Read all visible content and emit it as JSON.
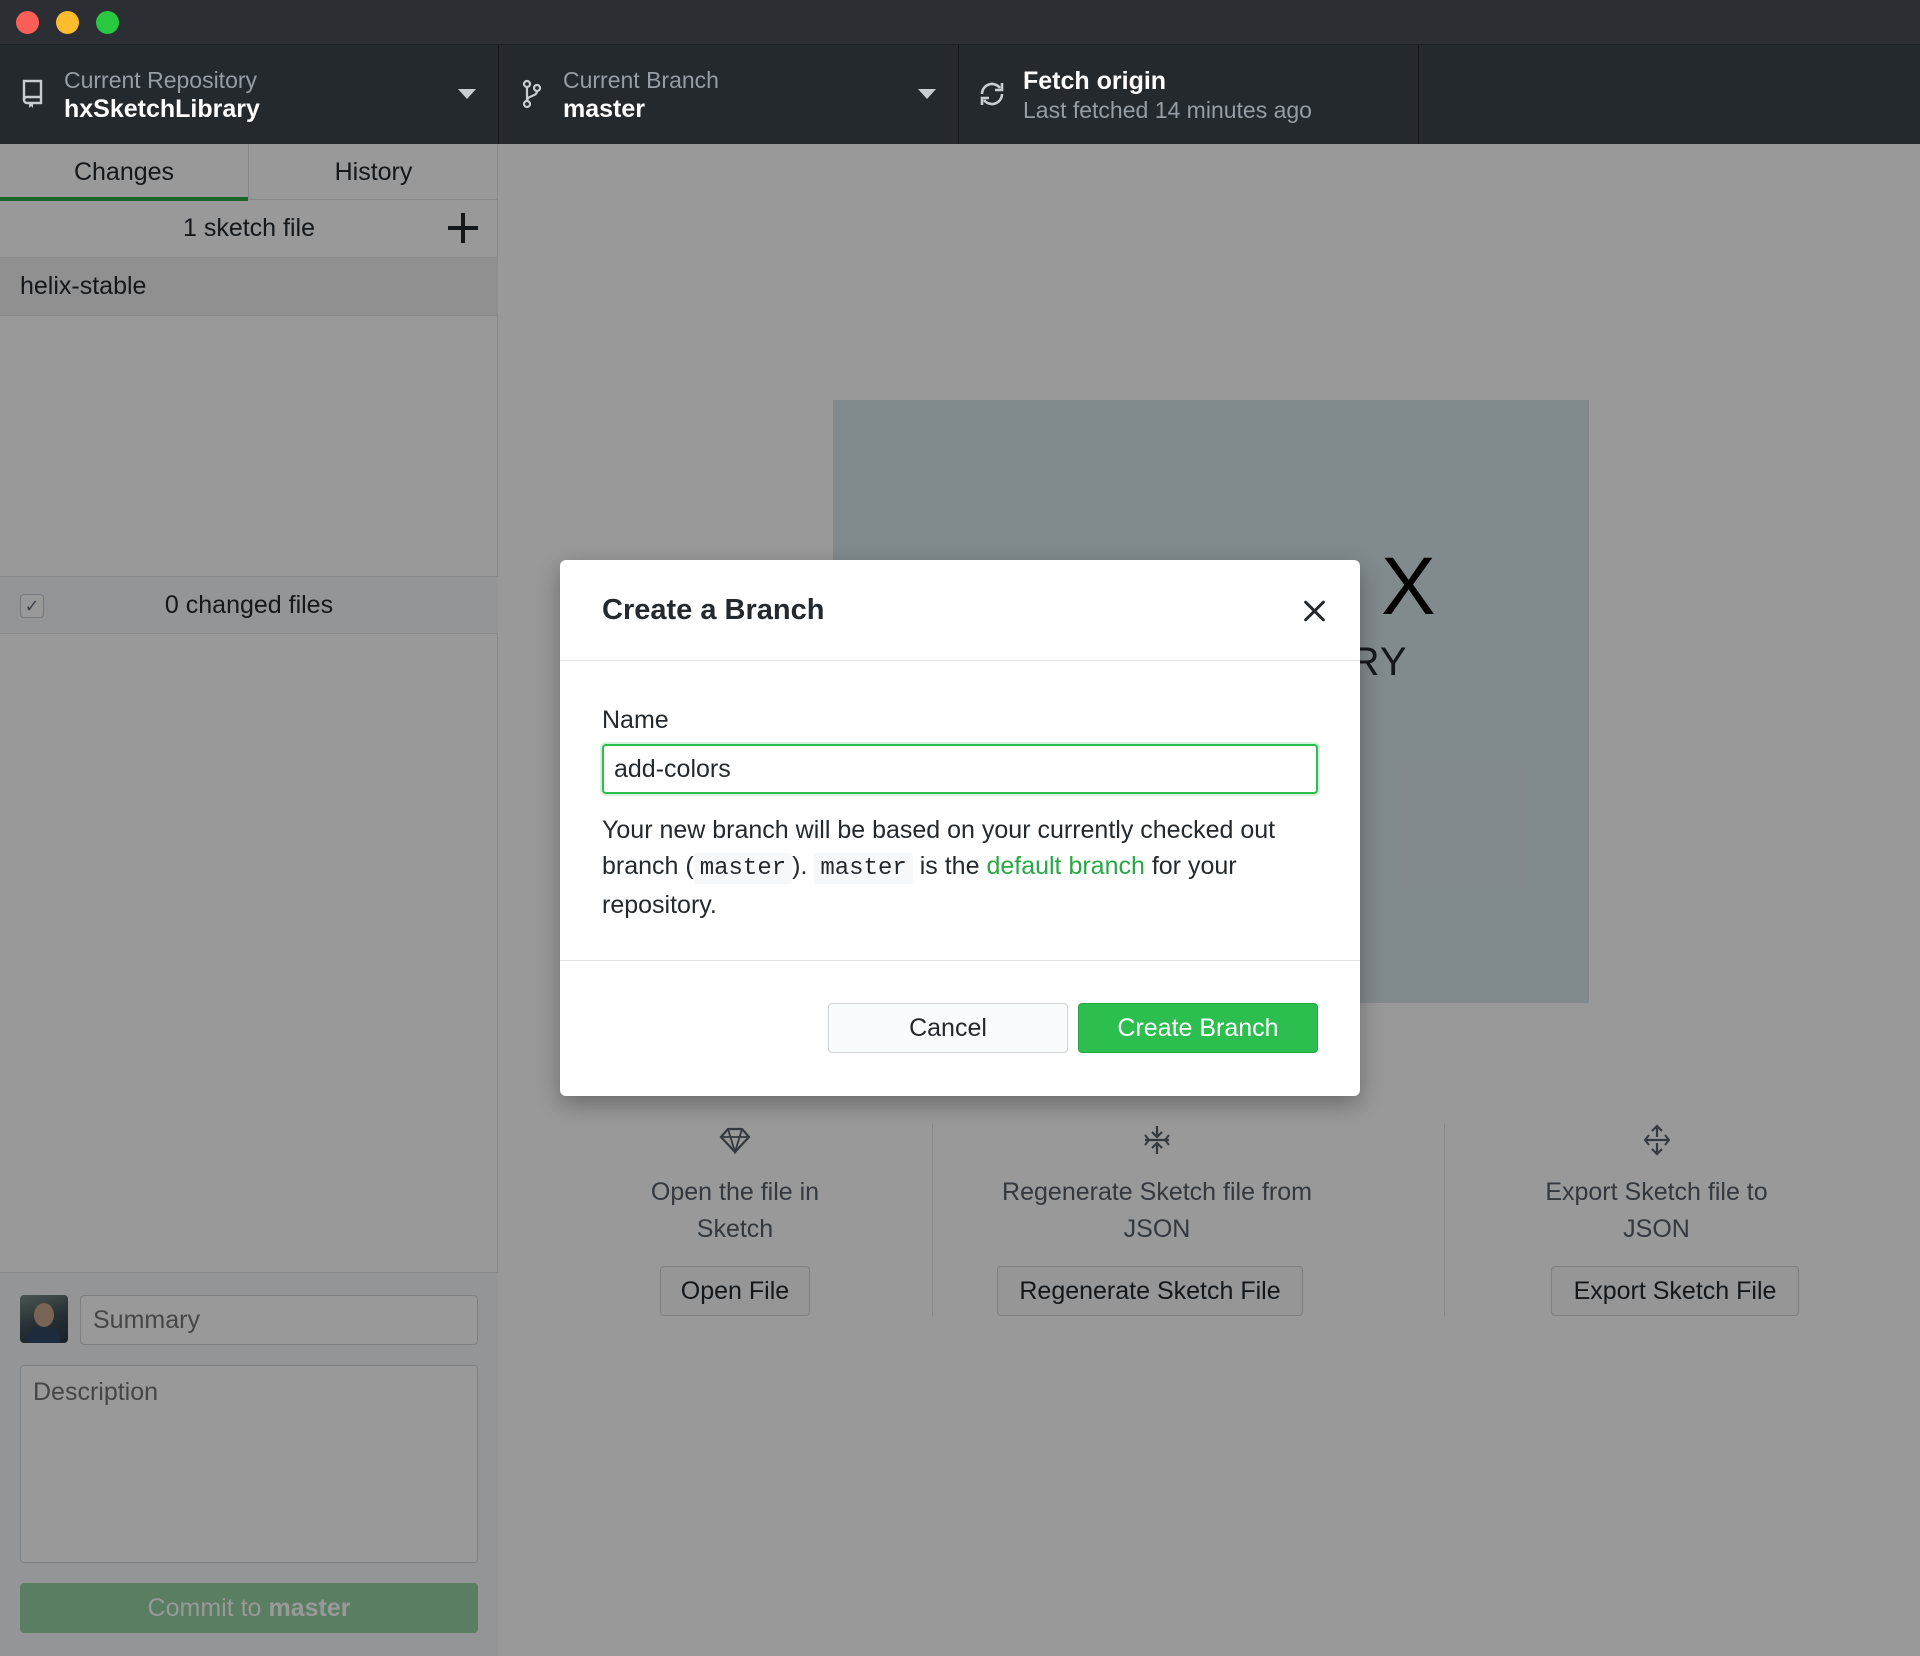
{
  "toolbar": {
    "repo_label": "Current Repository",
    "repo_value": "hxSketchLibrary",
    "branch_label": "Current Branch",
    "branch_value": "master",
    "fetch_title": "Fetch origin",
    "fetch_subtitle": "Last fetched 14 minutes ago"
  },
  "sidebar": {
    "tabs": [
      {
        "label": "Changes",
        "active": true
      },
      {
        "label": "History",
        "active": false
      }
    ],
    "sketch_count": "1 sketch file",
    "documents": [
      {
        "label": "helix-stable"
      }
    ],
    "changed_files": "0 changed files",
    "commit": {
      "summary_placeholder": "Summary",
      "description_placeholder": "Description",
      "button_prefix": "Commit to",
      "button_branch": "master"
    }
  },
  "main": {
    "preview": {
      "title_fragment": "X",
      "subtitle_fragment": "ARY"
    },
    "actions": [
      {
        "icon": "sketch-diamond-icon",
        "text": "Open the file in Sketch",
        "button": "Open File"
      },
      {
        "icon": "regenerate-icon",
        "text": "Regenerate Sketch file from JSON",
        "button": "Regenerate Sketch File"
      },
      {
        "icon": "export-icon",
        "text": "Export Sketch file to JSON",
        "button": "Export Sketch File"
      }
    ]
  },
  "dialog": {
    "title": "Create a Branch",
    "name_label": "Name",
    "name_value": "add-colors",
    "help_part1": "Your new branch will be based on your currently checked out branch (",
    "help_code1": "master",
    "help_part2": "). ",
    "help_code2": "master",
    "help_part3": " is the ",
    "help_link": "default branch",
    "help_part4": " for your repository.",
    "cancel_label": "Cancel",
    "create_label": "Create Branch"
  },
  "colors": {
    "accent_green": "#2cbe4e",
    "toolbar_bg": "#24292e",
    "link_green": "#28a745"
  }
}
